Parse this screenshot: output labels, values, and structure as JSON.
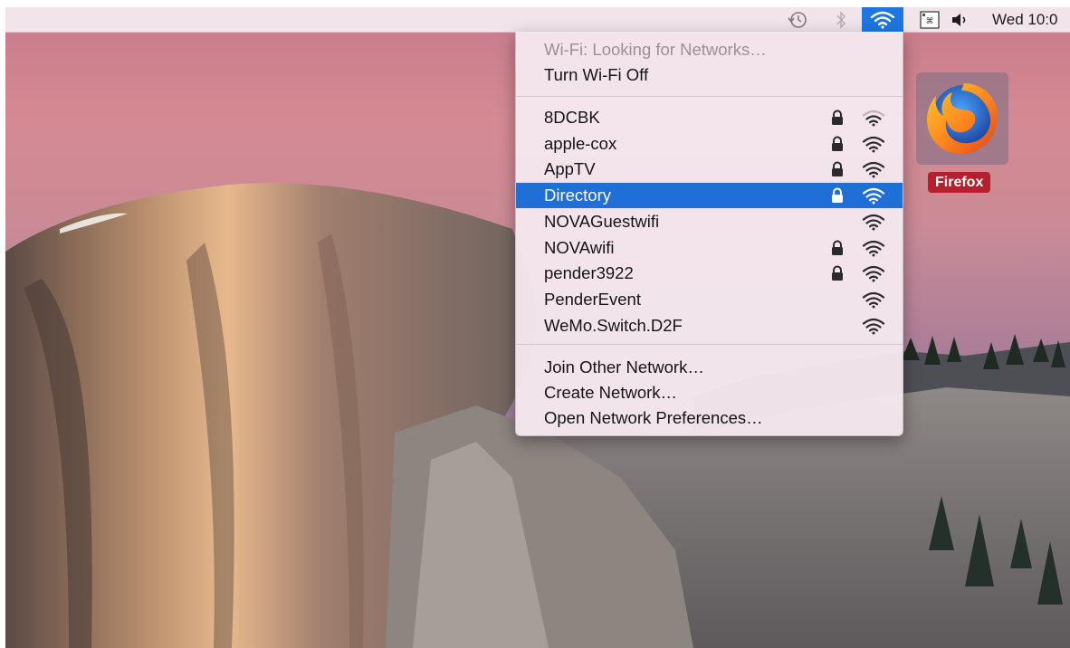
{
  "menubar": {
    "icons": [
      "time-machine-icon",
      "bluetooth-icon",
      "wifi-icon",
      "input-source-icon",
      "volume-icon"
    ],
    "clock": "Wed 10:0"
  },
  "wifi_menu": {
    "status": "Wi-Fi: Looking for Networks…",
    "toggle": "Turn Wi-Fi Off",
    "networks": [
      {
        "name": "8DCBK",
        "locked": true,
        "signal_bars": 2
      },
      {
        "name": "apple-cox",
        "locked": true,
        "signal_bars": 3
      },
      {
        "name": "AppTV",
        "locked": true,
        "signal_bars": 3
      },
      {
        "name": "Directory",
        "locked": true,
        "signal_bars": 3,
        "selected": true
      },
      {
        "name": "NOVAGuestwifi",
        "locked": false,
        "signal_bars": 3
      },
      {
        "name": "NOVAwifi",
        "locked": true,
        "signal_bars": 3
      },
      {
        "name": "pender3922",
        "locked": true,
        "signal_bars": 3
      },
      {
        "name": "PenderEvent",
        "locked": false,
        "signal_bars": 3
      },
      {
        "name": "WeMo.Switch.D2F",
        "locked": false,
        "signal_bars": 3
      }
    ],
    "actions": {
      "join": "Join Other Network…",
      "create": "Create Network…",
      "preferences": "Open Network Preferences…"
    }
  },
  "desktop": {
    "firefox_label": "Firefox"
  },
  "colors": {
    "selection": "#1f6fd6",
    "firefox_label_bg": "#b4202d"
  }
}
